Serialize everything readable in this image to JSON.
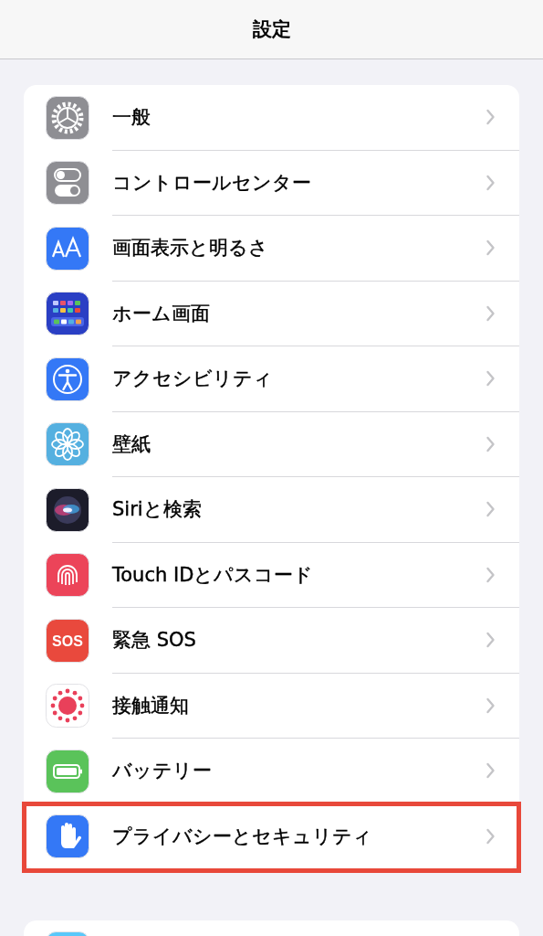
{
  "nav_bar": {
    "title": "設定"
  },
  "groups": [
    {
      "items": [
        {
          "label": "一般",
          "highlighted": false
        },
        {
          "label": "コントロールセンター",
          "highlighted": false
        },
        {
          "label": "画面表示と明るさ",
          "highlighted": false
        },
        {
          "label": "ホーム画面",
          "highlighted": false
        },
        {
          "label": "アクセシビリティ",
          "highlighted": false
        },
        {
          "label": "壁紙",
          "highlighted": false
        },
        {
          "label": "Siriと検索",
          "highlighted": false
        },
        {
          "label": "Touch IDとパスコード",
          "highlighted": false
        },
        {
          "label": "緊急 SOS",
          "icon_text": "SOS",
          "highlighted": false
        },
        {
          "label": "接触通知",
          "highlighted": false
        },
        {
          "label": "バッテリー",
          "highlighted": false
        },
        {
          "label": "プライバシーとセキュリティ",
          "highlighted": true
        }
      ]
    },
    {
      "items": [
        {
          "highlighted": false
        }
      ]
    }
  ]
}
